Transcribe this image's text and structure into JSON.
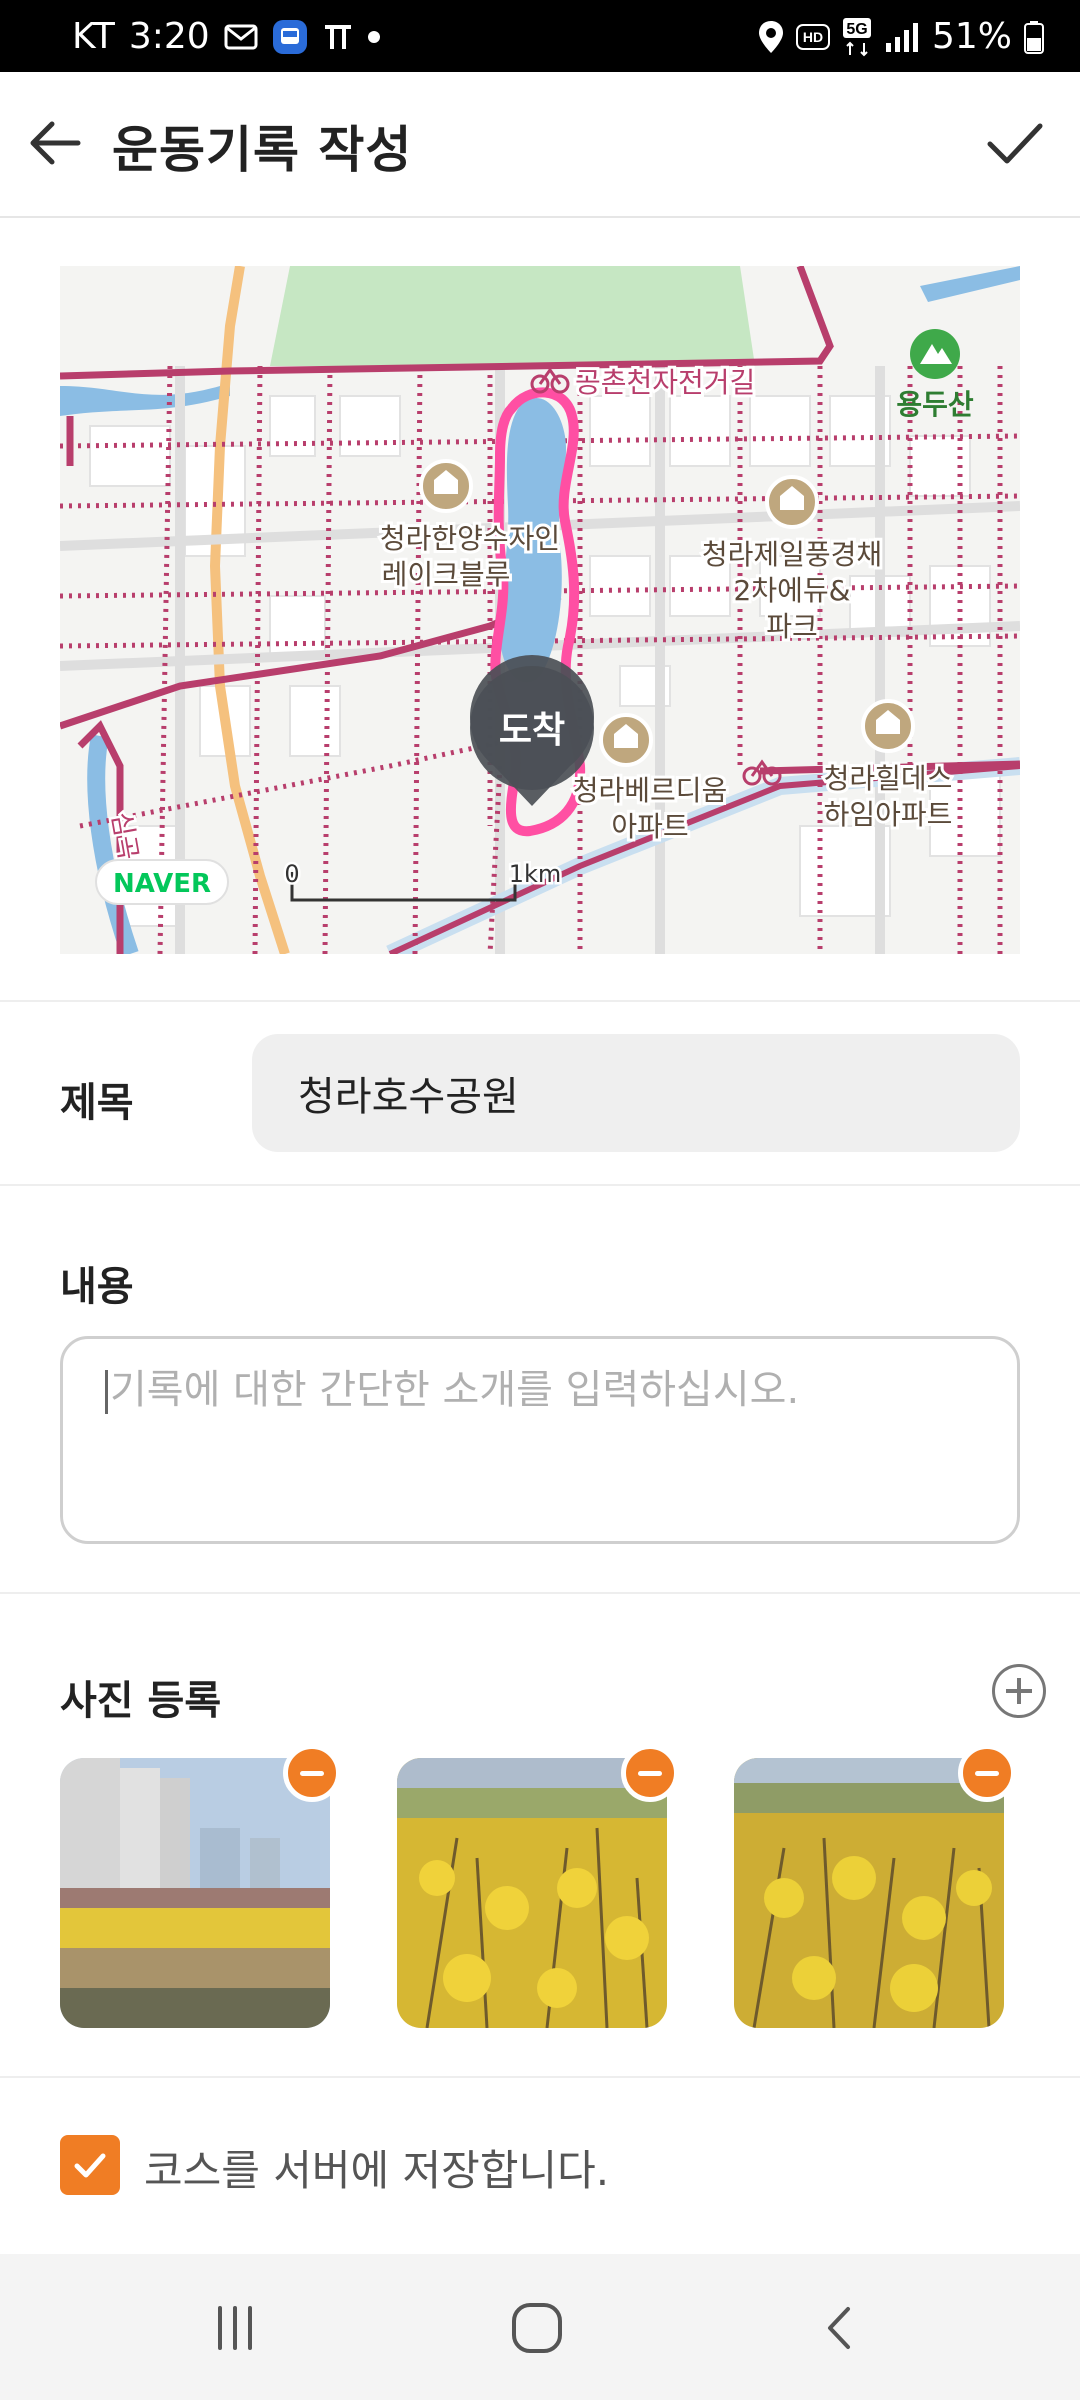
{
  "status_bar": {
    "carrier": "KT",
    "time": "3:20",
    "battery": "51%",
    "network": "5G",
    "hd_label": "HD",
    "icons": [
      "mail-icon",
      "bus-app-icon",
      "tmap-icon",
      "dot-icon",
      "location-icon",
      "hd-icon",
      "5g-icon",
      "signal-icon",
      "battery-icon"
    ]
  },
  "header": {
    "title": "운동기록 작성",
    "back_icon": "arrow-left-icon",
    "confirm_icon": "checkmark-icon"
  },
  "map": {
    "labels": {
      "bike_road": "공촌천자전거길",
      "mountain": "용두산",
      "apt1_line1": "청라한양수자인",
      "apt1_line2": "레이크블루",
      "apt2_line1": "청라제일풍경채",
      "apt2_line2": "2차에듀&",
      "apt2_line3": "파크",
      "apt3_line1": "청라베르디움",
      "apt3_line2": "아파트",
      "apt4_line1": "청라힐데스",
      "apt4_line2": "하임아파트",
      "stream": "심곡천",
      "marker": "도착",
      "logo": "NAVER",
      "scale_start": "0",
      "scale_end": "1km"
    },
    "colors": {
      "route": "#ff4fa3",
      "road": "#b83e6c",
      "water": "#7fb6df",
      "park": "#c3e6c1"
    }
  },
  "form": {
    "title_label": "제목",
    "title_value": "청라호수공원",
    "content_label": "내용",
    "content_placeholder": "기록에 대한 간단한 소개를 입력하십시오.",
    "photo_label": "사진 등록",
    "add_photo_icon": "plus-circle-icon",
    "photos": [
      {
        "name": "photo-1",
        "remove_icon": "minus-circle-icon"
      },
      {
        "name": "photo-2",
        "remove_icon": "minus-circle-icon"
      },
      {
        "name": "photo-3",
        "remove_icon": "minus-circle-icon"
      }
    ],
    "save_course_label": "코스를 서버에 저장합니다.",
    "save_course_checked": true
  },
  "nav_bar": {
    "icons": [
      "recent-apps-icon",
      "home-icon",
      "back-icon"
    ]
  },
  "colors": {
    "accent": "#f07d24",
    "input_bg": "#efefef"
  }
}
